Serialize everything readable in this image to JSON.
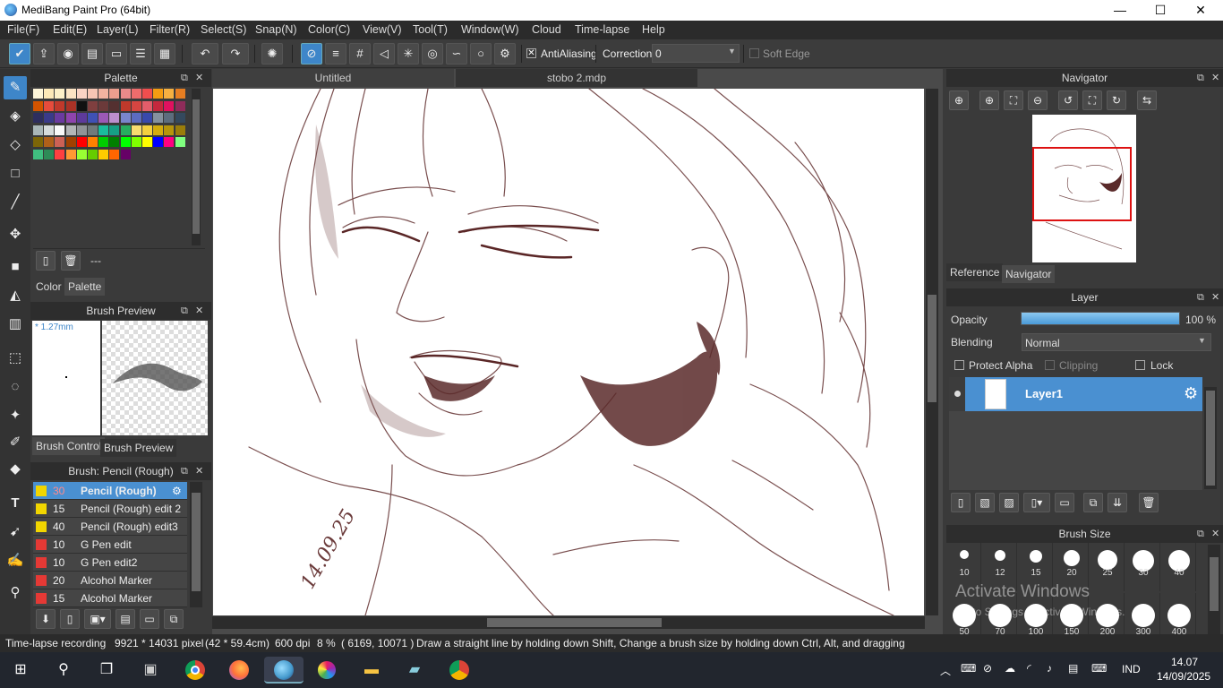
{
  "window": {
    "title": "MediBang Paint Pro (64bit)",
    "minimize": "—",
    "maximize": "☐",
    "close": "✕"
  },
  "menu": [
    "File(F)",
    "Edit(E)",
    "Layer(L)",
    "Filter(R)",
    "Select(S)",
    "Snap(N)",
    "Color(C)",
    "View(V)",
    "Tool(T)",
    "Window(W)",
    "Cloud",
    "Time-lapse",
    "Help"
  ],
  "toolbar": {
    "antialiasing_label": "AntiAliasing",
    "antialiasing_checked": true,
    "correction_label": "Correction",
    "correction_value": "0",
    "soft_edge_label": "Soft Edge",
    "soft_edge_checked": false
  },
  "palette_panel": {
    "title": "Palette",
    "footer_text": "---",
    "tab_color": "Color",
    "tab_palette": "Palette",
    "colors": [
      "#fdf5d8",
      "#fde9b8",
      "#fdf0c8",
      "#fce4c4",
      "#f9d3c4",
      "#f7c6b4",
      "#f3b3a0",
      "#ec9d8d",
      "#e98a8a",
      "#ef6c6c",
      "#f04e4e",
      "#f39c12",
      "#f5b041",
      "#e67e22",
      "#d35400",
      "#e74c3c",
      "#c0392b",
      "#a93226",
      "#111111",
      "#7f3f3f",
      "#6b3a3a",
      "#543030",
      "#c0392b",
      "#d64541",
      "#e35d6a",
      "#c5283d",
      "#e0115f",
      "#8e2c5a",
      "#2e2e5e",
      "#3a3a8a",
      "#6a3aa0",
      "#8e44ad",
      "#5d3a9b",
      "#3f51b5",
      "#9b59b6",
      "#bb8fce",
      "#7986cb",
      "#5c6bc0",
      "#3949ab",
      "#85929e",
      "#5d6d7e",
      "#34495e",
      "#aab7b8",
      "#d5dbdb",
      "#f8f9f9",
      "#b3b6b7",
      "#909497",
      "#707b7c",
      "#1abc9c",
      "#16a085",
      "#27ae60",
      "#f7dc6f",
      "#f4d03f",
      "#d4ac0d",
      "#b7950b",
      "#9a7d0a",
      "#7d6608",
      "#af601a",
      "#cd6155",
      "#a04000",
      "#ff0000",
      "#ff8000",
      "#00cc00",
      "#008000",
      "#00ff00",
      "#80ff00",
      "#ffff00",
      "#0000ff",
      "#ff0080",
      "#80ff80",
      "#40c080",
      "#2e8b57",
      "#ff4040",
      "#ff9933",
      "#99ff33",
      "#66cc00",
      "#ffcc00",
      "#ff6600",
      "#660066"
    ]
  },
  "brush_preview": {
    "title": "Brush Preview",
    "size": "* 1.27mm",
    "tab_brush_control": "Brush Control",
    "tab_brush_preview": "Brush Preview"
  },
  "brush_list": {
    "title": "Brush: Pencil (Rough)",
    "items": [
      {
        "size": "30",
        "name": "Pencil (Rough)",
        "color": "#f2d600",
        "selected": true
      },
      {
        "size": "15",
        "name": "Pencil (Rough) edit 2",
        "color": "#f2d600"
      },
      {
        "size": "40",
        "name": "Pencil (Rough) edit3",
        "color": "#f2d600"
      },
      {
        "size": "10",
        "name": "G Pen edit",
        "color": "#e53935"
      },
      {
        "size": "10",
        "name": "G Pen edit2",
        "color": "#e53935"
      },
      {
        "size": "20",
        "name": "Alcohol Marker",
        "color": "#e53935"
      },
      {
        "size": "15",
        "name": "Alcohol Marker",
        "color": "#e53935"
      }
    ]
  },
  "documents": {
    "tab1": "Untitled",
    "tab2": "stobo 2.mdp"
  },
  "artwork": {
    "signature": "14.09.25"
  },
  "navigator": {
    "title": "Navigator",
    "tab_reference": "Reference",
    "tab_navigator": "Navigator"
  },
  "layer_panel": {
    "title": "Layer",
    "opacity_label": "Opacity",
    "opacity_value": "100 %",
    "opacity_fraction": 1.0,
    "blending_label": "Blending",
    "blending_value": "Normal",
    "protect_alpha": "Protect Alpha",
    "clipping": "Clipping",
    "lock": "Lock",
    "layer_name": "Layer1"
  },
  "brush_size_panel": {
    "title": "Brush Size",
    "sizes": [
      "10",
      "12",
      "15",
      "20",
      "25",
      "30",
      "40",
      "50",
      "70",
      "100",
      "150",
      "200",
      "300",
      "400"
    ]
  },
  "watermark": {
    "line1": "Activate Windows",
    "line2": "Go to Settings to activate Windows."
  },
  "status_bar": {
    "recording": "Time-lapse recording",
    "pixels": "9921 * 14031 pixel",
    "physical": "(42 * 59.4cm)",
    "dpi": "600 dpi",
    "zoom": "8 %",
    "coords": "( 6169, 10071 )",
    "hint": "Draw a straight line by holding down Shift, Change a brush size by holding down Ctrl, Alt, and dragging"
  },
  "taskbar": {
    "language": "IND",
    "time": "14.07",
    "date": "14/09/2025"
  }
}
